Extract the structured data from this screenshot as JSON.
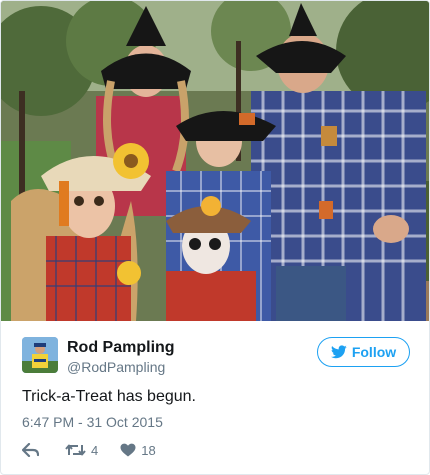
{
  "user": {
    "display_name": "Rod Pampling",
    "handle": "@RodPampling"
  },
  "follow": {
    "label": "Follow"
  },
  "tweet": {
    "text": "Trick-a-Treat has begun.",
    "timestamp": "6:47 PM - 31 Oct 2015"
  },
  "actions": {
    "retweet_count": "4",
    "like_count": "18"
  },
  "colors": {
    "brand": "#1da1f2",
    "secondary_text": "#657786",
    "primary_text": "#14171a",
    "border": "#e1e8ed"
  },
  "icons": {
    "follow": "twitter-bird-icon",
    "reply": "reply-icon",
    "retweet": "retweet-icon",
    "like": "heart-icon"
  }
}
